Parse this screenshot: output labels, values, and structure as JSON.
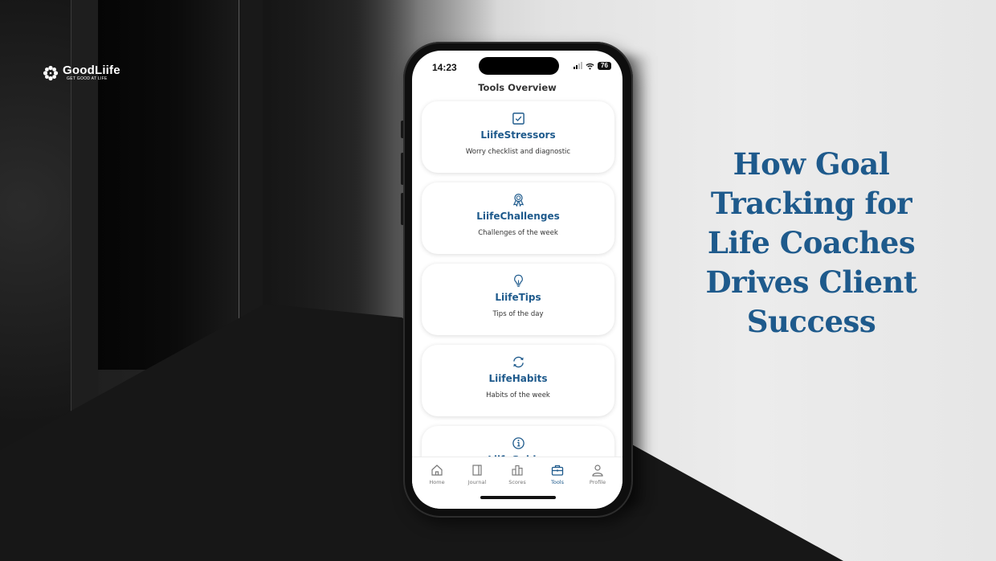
{
  "brand": {
    "name": "GoodLiife",
    "tagline": "GET GOOD AT LIFE",
    "icon": "flower-icon"
  },
  "headline": {
    "lines": [
      "How Goal",
      "Tracking for",
      "Life Coaches",
      "Drives Client",
      "Success"
    ],
    "color": "#1e5a8c"
  },
  "phone": {
    "status_bar": {
      "time": "14:23",
      "battery": "76",
      "icons": [
        "signal-icon",
        "wifi-icon",
        "battery-icon"
      ]
    },
    "page_title": "Tools Overview",
    "accent_color": "#1e5a8c",
    "cards": [
      {
        "icon": "checkbox-icon",
        "title": "LiifeStressors",
        "description": "Worry checklist and diagnostic"
      },
      {
        "icon": "award-ribbon-icon",
        "title": "LiifeChallenges",
        "description": "Challenges of the week"
      },
      {
        "icon": "lightbulb-icon",
        "title": "LiifeTips",
        "description": "Tips of the day"
      },
      {
        "icon": "refresh-icon",
        "title": "LiifeHabits",
        "description": "Habits of the week"
      },
      {
        "icon": "info-icon",
        "title": "LiifeGuides",
        "description": ""
      }
    ],
    "tabbar": [
      {
        "icon": "home-icon",
        "label": "Home",
        "active": false
      },
      {
        "icon": "journal-icon",
        "label": "Journal",
        "active": false
      },
      {
        "icon": "bar-chart-icon",
        "label": "Scores",
        "active": false
      },
      {
        "icon": "briefcase-icon",
        "label": "Tools",
        "active": true
      },
      {
        "icon": "profile-icon",
        "label": "Profile",
        "active": false
      }
    ]
  }
}
